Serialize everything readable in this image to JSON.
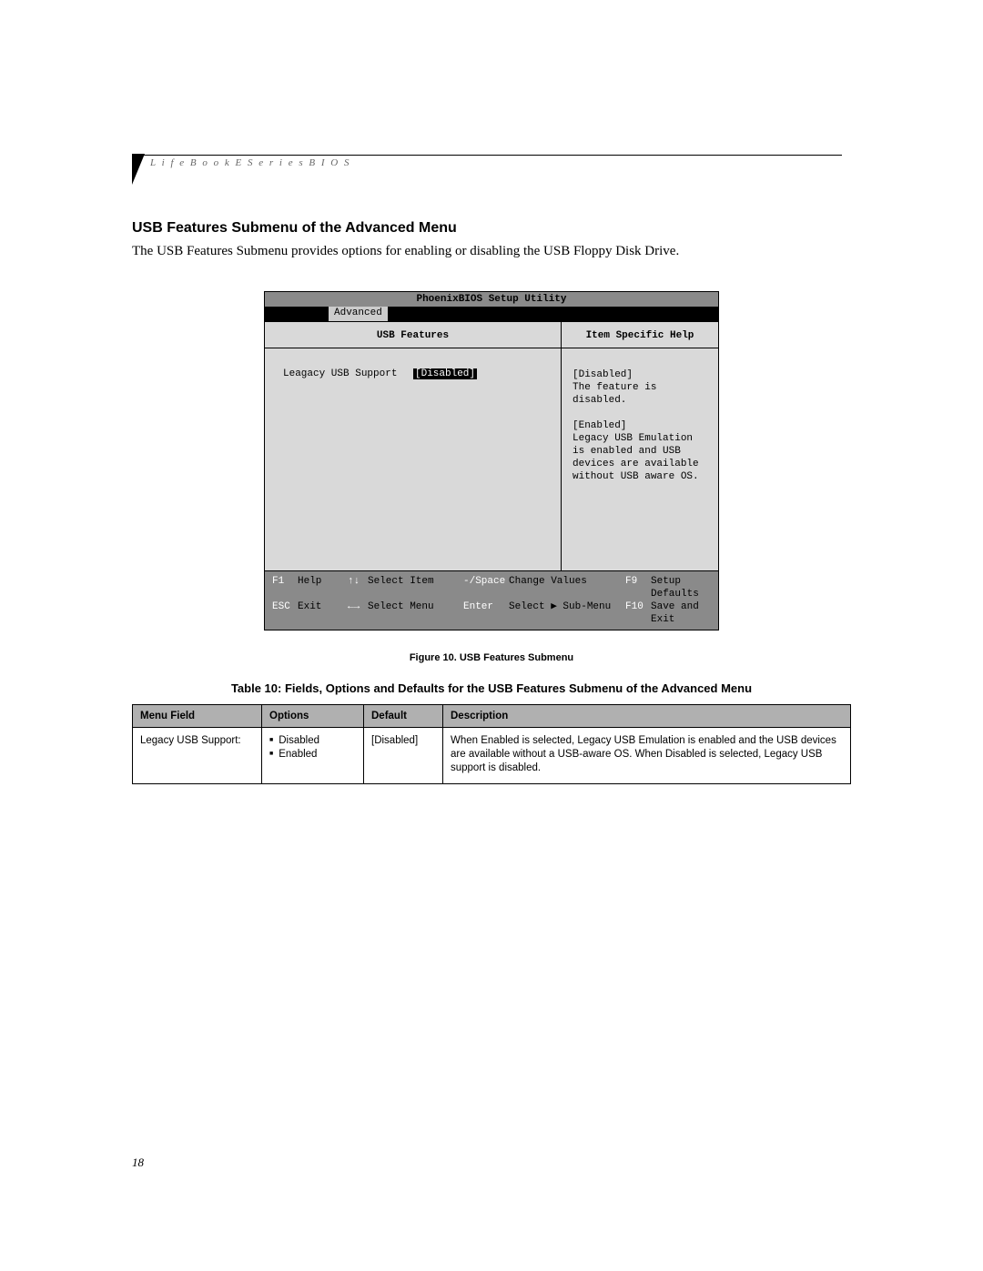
{
  "header": {
    "running_head": "L i f e B o o k   E   S e r i e s   B I O S"
  },
  "section": {
    "title": "USB Features Submenu of the Advanced Menu",
    "intro": "The USB Features Submenu provides options for enabling or disabling the USB Floppy Disk Drive."
  },
  "bios": {
    "title": "PhoenixBIOS Setup Utility",
    "active_tab": "Advanced",
    "left_title": "USB Features",
    "right_title": "Item Specific Help",
    "setting_label": "Leagacy USB Support",
    "setting_value": "[Disabled]",
    "help_block1_title": "[Disabled]",
    "help_block1_body": "The feature is disabled.",
    "help_block2_title": "[Enabled]",
    "help_block2_body": "Legacy USB Emulation is enabled and USB devices are available without USB aware OS.",
    "footer": {
      "r1": {
        "k1": "F1",
        "a1": "Help",
        "k2": "↑↓",
        "a2": "Select Item",
        "k3": "-/Space",
        "a3": "Change Values",
        "k4": "F9",
        "a4": "Setup Defaults"
      },
      "r2": {
        "k1": "ESC",
        "a1": "Exit",
        "k2": "←→",
        "a2": "Select Menu",
        "k3": "Enter",
        "a3": "Select ▶ Sub-Menu",
        "k4": "F10",
        "a4": "Save and Exit"
      }
    }
  },
  "figure_caption": "Figure 10.  USB Features Submenu",
  "table_caption": "Table 10: Fields, Options and Defaults for the USB Features Submenu of the Advanced Menu",
  "table": {
    "headers": {
      "menu": "Menu Field",
      "options": "Options",
      "default": "Default",
      "description": "Description"
    },
    "rows": [
      {
        "menu": "Legacy USB Support:",
        "options": [
          "Disabled",
          "Enabled"
        ],
        "default": "[Disabled]",
        "description": "When Enabled is selected, Legacy USB Emulation is enabled and the USB devices are available without a USB-aware OS. When Disabled is selected, Legacy USB support is disabled."
      }
    ]
  },
  "page_number": "18"
}
